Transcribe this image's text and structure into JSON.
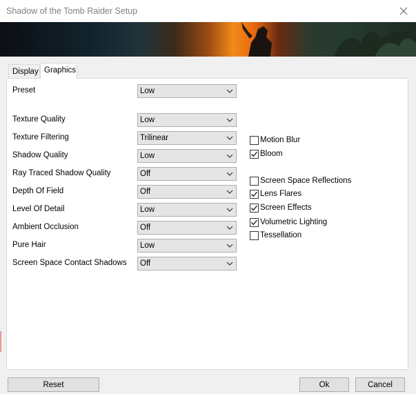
{
  "window": {
    "title": "Shadow of the Tomb Raider Setup"
  },
  "tabs": [
    {
      "label": "Display"
    },
    {
      "label": "Graphics"
    }
  ],
  "settings": [
    {
      "label": "Preset",
      "value": "Low"
    },
    {
      "label": "Texture Quality",
      "value": "Low"
    },
    {
      "label": "Texture Filtering",
      "value": "Trilinear"
    },
    {
      "label": "Shadow Quality",
      "value": "Low"
    },
    {
      "label": "Ray Traced Shadow Quality",
      "value": "Off"
    },
    {
      "label": "Depth Of Field",
      "value": "Off"
    },
    {
      "label": "Level Of Detail",
      "value": "Low"
    },
    {
      "label": "Ambient Occlusion",
      "value": "Off"
    },
    {
      "label": "Pure Hair",
      "value": "Low"
    },
    {
      "label": "Screen Space Contact Shadows",
      "value": "Off"
    }
  ],
  "checkboxes": [
    {
      "label": "Motion Blur",
      "checked": false
    },
    {
      "label": "Bloom",
      "checked": true
    },
    {
      "label": "Screen Space Reflections",
      "checked": false
    },
    {
      "label": "Lens Flares",
      "checked": true
    },
    {
      "label": "Screen Effects",
      "checked": true
    },
    {
      "label": "Volumetric Lighting",
      "checked": true
    },
    {
      "label": "Tessellation",
      "checked": false
    }
  ],
  "buttons": {
    "reset": "Reset",
    "ok": "Ok",
    "cancel": "Cancel"
  }
}
